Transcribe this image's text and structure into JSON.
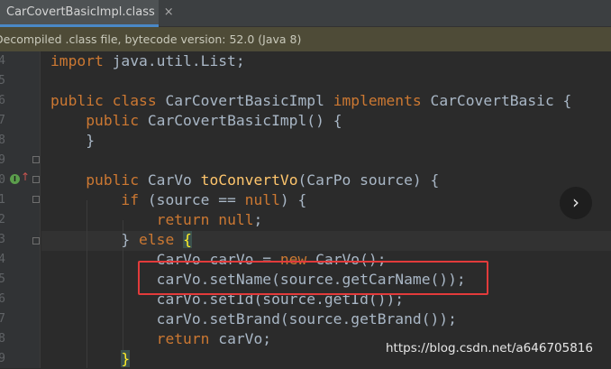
{
  "tab": {
    "filename": "CarCovertBasicImpl.class",
    "close": "×"
  },
  "banner": {
    "text": "Decompiled .class file, bytecode version: 52.0 (Java 8)"
  },
  "gutter": {
    "line_numbers": [
      "4",
      "5",
      "6",
      "7",
      "8",
      "9",
      "0",
      "1",
      "2",
      "3",
      "4",
      "5",
      "6",
      "7",
      "8",
      "9"
    ],
    "icons": {
      "implements_marker": "implementation-icon",
      "override_marker": "override-arrow-icon"
    }
  },
  "code": {
    "import_kw": "import",
    "import_rest": " java.util.List;",
    "class_mod": "public class",
    "class_name": " CarCovertBasicImpl ",
    "implements_kw": "implements",
    "interface_name": " CarCovertBasic {",
    "ctor_mod": "public",
    "ctor_rest": " CarCovertBasicImpl() {",
    "ctor_close": "}",
    "method_mod": "public",
    "method_type": " CarVo ",
    "method_name": "toConvertVo",
    "method_params": "(CarPo source) {",
    "if_kw": "if",
    "if_cond_a": " (source == ",
    "null_kw": "null",
    "if_cond_b": ") {",
    "return_kw": "return",
    "return_null_sp": " ",
    "return_null": "null",
    "return_null_end": ";",
    "else_pre": "} ",
    "else_kw": "else",
    "else_sp": " ",
    "else_brace": "{",
    "stmt_1_a": "CarVo carVo = ",
    "new_kw": "new",
    "stmt_1_b": " CarVo();",
    "stmt_2": "carVo.setName(source.getCarName());",
    "stmt_3": "carVo.setId(source.getId());",
    "stmt_4": "carVo.setBrand(source.getBrand());",
    "return_kw2": "return",
    "return_var": " carVo;",
    "end_brace": "}"
  },
  "overlay": {
    "next_button": "›",
    "watermark": "https://blog.csdn.net/a646705816"
  },
  "colors": {
    "keyword": "#cc7832",
    "method": "#ffc66d",
    "text": "#a9b7c6",
    "highlight_box": "#e23b3b"
  }
}
